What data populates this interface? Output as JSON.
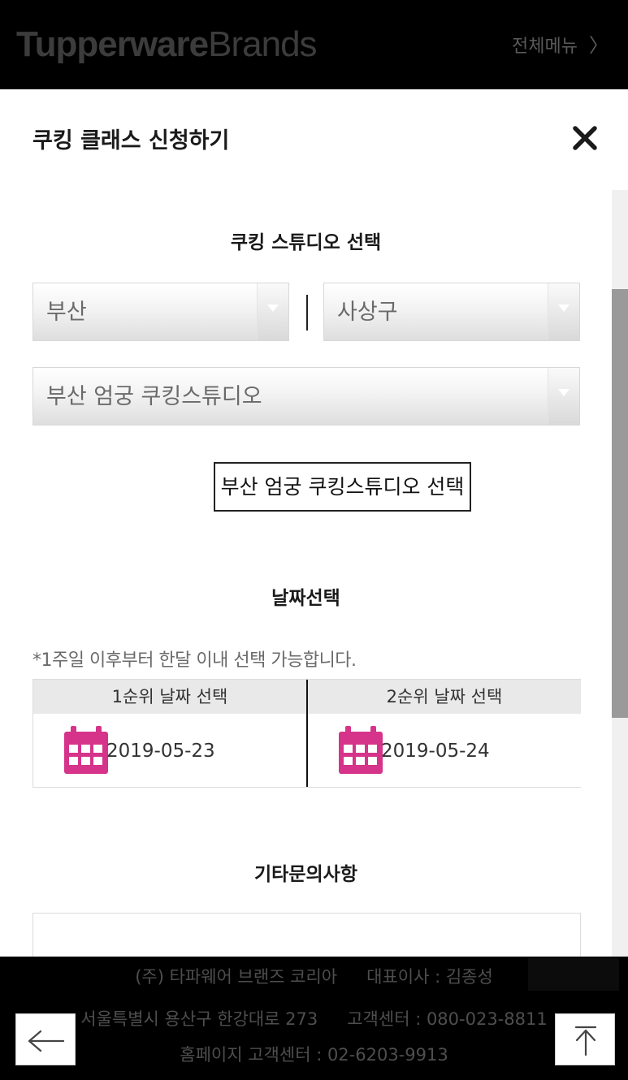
{
  "header": {
    "logo_bold": "Tupperware",
    "logo_light": "Brands",
    "menu_label": "전체메뉴",
    "menu_chevron": "〉"
  },
  "modal": {
    "title": "쿠킹 클래스 신청하기",
    "close_icon": "close-icon",
    "studio_section": {
      "title": "쿠킹 스튜디오 선택",
      "region_select": "부산",
      "district_select": "사상구",
      "studio_select": "부산 엄궁 쿠킹스튜디오",
      "confirm_button": "부산 엄궁 쿠킹스튜디오 선택"
    },
    "date_section": {
      "title": "날짜선택",
      "notice": "*1주일 이후부터 한달 이내 선택 가능합니다.",
      "columns": [
        {
          "header": "1순위 날짜 선택",
          "value": "2019-05-23",
          "icon": "calendar-icon"
        },
        {
          "header": "2순위 날짜 선택",
          "value": "2019-05-24",
          "icon": "calendar-icon"
        }
      ]
    },
    "inquiry_section": {
      "title": "기타문의사항"
    }
  },
  "footer": {
    "company": "(주) 타파웨어 브랜즈 코리아",
    "ceo": "대표이사 : 김종성",
    "address": "서울특별시 용산구 한강대로 273",
    "customer_center": "고객센터 : 080-023-8811",
    "web_customer_center": "홈페이지 고객센터 : 02-6203-9913"
  },
  "colors": {
    "calendar": "#d6338a",
    "background": "#000000",
    "modal": "#ffffff"
  }
}
